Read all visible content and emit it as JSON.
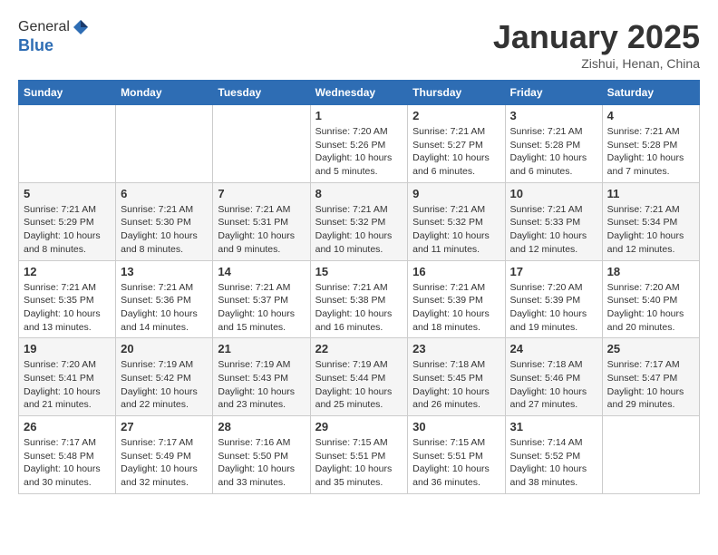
{
  "header": {
    "logo_line1": "General",
    "logo_line2": "Blue",
    "title": "January 2025",
    "subtitle": "Zishui, Henan, China"
  },
  "days_of_week": [
    "Sunday",
    "Monday",
    "Tuesday",
    "Wednesday",
    "Thursday",
    "Friday",
    "Saturday"
  ],
  "weeks": [
    [
      {
        "day": "",
        "info": ""
      },
      {
        "day": "",
        "info": ""
      },
      {
        "day": "",
        "info": ""
      },
      {
        "day": "1",
        "info": "Sunrise: 7:20 AM\nSunset: 5:26 PM\nDaylight: 10 hours\nand 5 minutes."
      },
      {
        "day": "2",
        "info": "Sunrise: 7:21 AM\nSunset: 5:27 PM\nDaylight: 10 hours\nand 6 minutes."
      },
      {
        "day": "3",
        "info": "Sunrise: 7:21 AM\nSunset: 5:28 PM\nDaylight: 10 hours\nand 6 minutes."
      },
      {
        "day": "4",
        "info": "Sunrise: 7:21 AM\nSunset: 5:28 PM\nDaylight: 10 hours\nand 7 minutes."
      }
    ],
    [
      {
        "day": "5",
        "info": "Sunrise: 7:21 AM\nSunset: 5:29 PM\nDaylight: 10 hours\nand 8 minutes."
      },
      {
        "day": "6",
        "info": "Sunrise: 7:21 AM\nSunset: 5:30 PM\nDaylight: 10 hours\nand 8 minutes."
      },
      {
        "day": "7",
        "info": "Sunrise: 7:21 AM\nSunset: 5:31 PM\nDaylight: 10 hours\nand 9 minutes."
      },
      {
        "day": "8",
        "info": "Sunrise: 7:21 AM\nSunset: 5:32 PM\nDaylight: 10 hours\nand 10 minutes."
      },
      {
        "day": "9",
        "info": "Sunrise: 7:21 AM\nSunset: 5:32 PM\nDaylight: 10 hours\nand 11 minutes."
      },
      {
        "day": "10",
        "info": "Sunrise: 7:21 AM\nSunset: 5:33 PM\nDaylight: 10 hours\nand 12 minutes."
      },
      {
        "day": "11",
        "info": "Sunrise: 7:21 AM\nSunset: 5:34 PM\nDaylight: 10 hours\nand 12 minutes."
      }
    ],
    [
      {
        "day": "12",
        "info": "Sunrise: 7:21 AM\nSunset: 5:35 PM\nDaylight: 10 hours\nand 13 minutes."
      },
      {
        "day": "13",
        "info": "Sunrise: 7:21 AM\nSunset: 5:36 PM\nDaylight: 10 hours\nand 14 minutes."
      },
      {
        "day": "14",
        "info": "Sunrise: 7:21 AM\nSunset: 5:37 PM\nDaylight: 10 hours\nand 15 minutes."
      },
      {
        "day": "15",
        "info": "Sunrise: 7:21 AM\nSunset: 5:38 PM\nDaylight: 10 hours\nand 16 minutes."
      },
      {
        "day": "16",
        "info": "Sunrise: 7:21 AM\nSunset: 5:39 PM\nDaylight: 10 hours\nand 18 minutes."
      },
      {
        "day": "17",
        "info": "Sunrise: 7:20 AM\nSunset: 5:39 PM\nDaylight: 10 hours\nand 19 minutes."
      },
      {
        "day": "18",
        "info": "Sunrise: 7:20 AM\nSunset: 5:40 PM\nDaylight: 10 hours\nand 20 minutes."
      }
    ],
    [
      {
        "day": "19",
        "info": "Sunrise: 7:20 AM\nSunset: 5:41 PM\nDaylight: 10 hours\nand 21 minutes."
      },
      {
        "day": "20",
        "info": "Sunrise: 7:19 AM\nSunset: 5:42 PM\nDaylight: 10 hours\nand 22 minutes."
      },
      {
        "day": "21",
        "info": "Sunrise: 7:19 AM\nSunset: 5:43 PM\nDaylight: 10 hours\nand 23 minutes."
      },
      {
        "day": "22",
        "info": "Sunrise: 7:19 AM\nSunset: 5:44 PM\nDaylight: 10 hours\nand 25 minutes."
      },
      {
        "day": "23",
        "info": "Sunrise: 7:18 AM\nSunset: 5:45 PM\nDaylight: 10 hours\nand 26 minutes."
      },
      {
        "day": "24",
        "info": "Sunrise: 7:18 AM\nSunset: 5:46 PM\nDaylight: 10 hours\nand 27 minutes."
      },
      {
        "day": "25",
        "info": "Sunrise: 7:17 AM\nSunset: 5:47 PM\nDaylight: 10 hours\nand 29 minutes."
      }
    ],
    [
      {
        "day": "26",
        "info": "Sunrise: 7:17 AM\nSunset: 5:48 PM\nDaylight: 10 hours\nand 30 minutes."
      },
      {
        "day": "27",
        "info": "Sunrise: 7:17 AM\nSunset: 5:49 PM\nDaylight: 10 hours\nand 32 minutes."
      },
      {
        "day": "28",
        "info": "Sunrise: 7:16 AM\nSunset: 5:50 PM\nDaylight: 10 hours\nand 33 minutes."
      },
      {
        "day": "29",
        "info": "Sunrise: 7:15 AM\nSunset: 5:51 PM\nDaylight: 10 hours\nand 35 minutes."
      },
      {
        "day": "30",
        "info": "Sunrise: 7:15 AM\nSunset: 5:51 PM\nDaylight: 10 hours\nand 36 minutes."
      },
      {
        "day": "31",
        "info": "Sunrise: 7:14 AM\nSunset: 5:52 PM\nDaylight: 10 hours\nand 38 minutes."
      },
      {
        "day": "",
        "info": ""
      }
    ]
  ]
}
